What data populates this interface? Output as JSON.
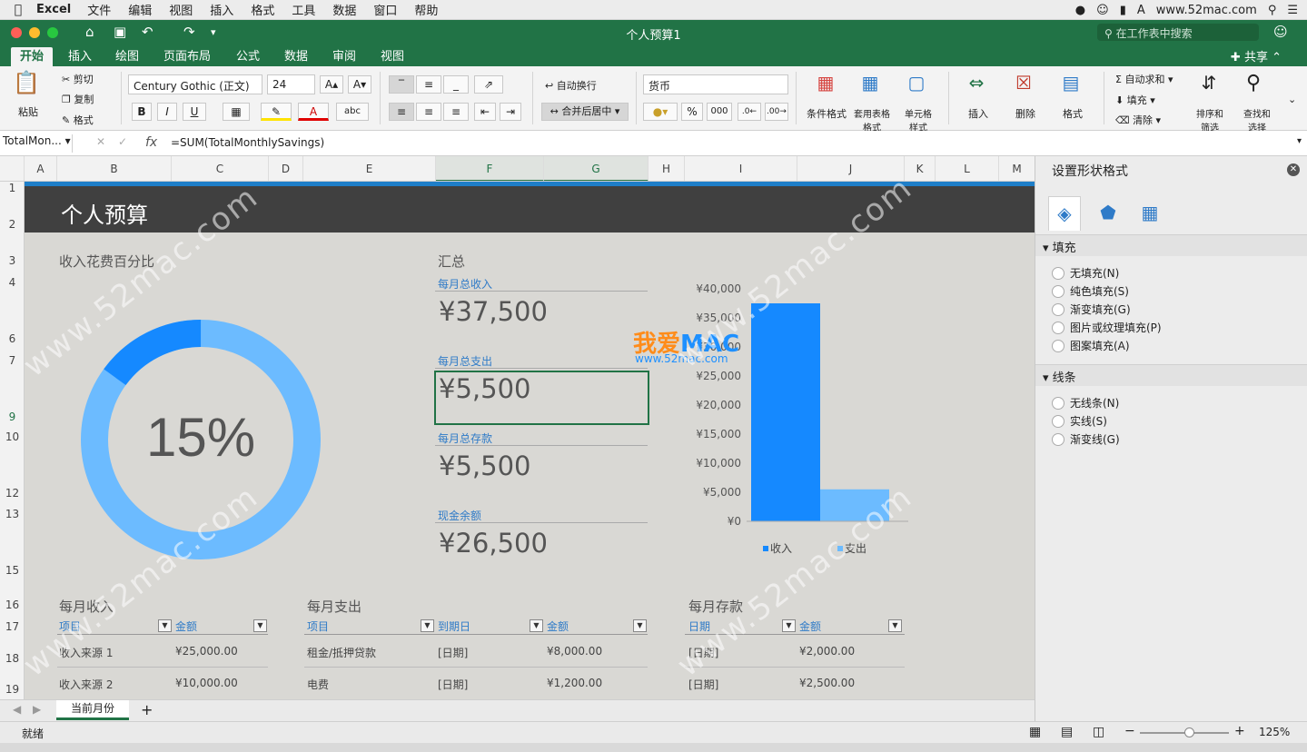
{
  "menubar": {
    "app": "Excel",
    "items": [
      "文件",
      "编辑",
      "视图",
      "插入",
      "格式",
      "工具",
      "数据",
      "窗口",
      "帮助"
    ],
    "site": "www.52mac.com"
  },
  "window": {
    "title": "个人预算1",
    "search_placeholder": "在工作表中搜索",
    "share": "共享"
  },
  "tabs": [
    "开始",
    "插入",
    "绘图",
    "页面布局",
    "公式",
    "数据",
    "审阅",
    "视图"
  ],
  "ribbon": {
    "paste": "粘贴",
    "cut": "剪切",
    "copy": "复制",
    "format_painter": "格式",
    "font_name": "Century Gothic (正文)",
    "font_size": "24",
    "bold": "B",
    "italic": "I",
    "underline": "U",
    "wrap": "自动换行",
    "merge": "合并后居中",
    "number_format": "货币",
    "percent": "%",
    "thousands": "000",
    "cond_format": "条件格式",
    "table_format": "套用表格格式",
    "cell_style": "单元格样式",
    "insert": "插入",
    "delete": "删除",
    "format": "格式",
    "autosum": "自动求和",
    "fill": "填充",
    "clear": "清除",
    "sort": "排序和筛选",
    "find": "查找和选择"
  },
  "formula_bar": {
    "name_box": "TotalMon...",
    "fx": "fx",
    "formula": "=SUM(TotalMonthlySavings)"
  },
  "columns": [
    "A",
    "B",
    "C",
    "D",
    "E",
    "F",
    "G",
    "H",
    "I",
    "J",
    "K",
    "L",
    "M"
  ],
  "rows": [
    "1",
    "2",
    "3",
    "4",
    "6",
    "7",
    "9",
    "10",
    "12",
    "13",
    "15",
    "16",
    "17",
    "18",
    "19"
  ],
  "sheet": {
    "title": "个人预算",
    "donut": {
      "label": "收入花费百分比",
      "percent_text": "15%",
      "percent": 0.15,
      "colors": {
        "spent": "#1589ff",
        "rest": "#6cbbff"
      }
    },
    "summary": {
      "heading": "汇总",
      "items": [
        {
          "label": "每月总收入",
          "value": "¥37,500"
        },
        {
          "label": "每月总支出",
          "value": "¥5,500"
        },
        {
          "label": "每月总存款",
          "value": "¥5,500"
        },
        {
          "label": "现金余额",
          "value": "¥26,500"
        }
      ]
    },
    "income": {
      "title": "每月收入",
      "headers": [
        "项目",
        "金额"
      ],
      "rows": [
        [
          "收入来源 1",
          "¥25,000.00"
        ],
        [
          "收入来源 2",
          "¥10,000.00"
        ]
      ]
    },
    "expense": {
      "title": "每月支出",
      "headers": [
        "项目",
        "到期日",
        "金额"
      ],
      "rows": [
        [
          "租金/抵押贷款",
          "[日期]",
          "¥8,000.00"
        ],
        [
          "电费",
          "[日期]",
          "¥1,200.00"
        ]
      ]
    },
    "savings": {
      "title": "每月存款",
      "headers": [
        "日期",
        "金额"
      ],
      "rows": [
        [
          "[日期]",
          "¥2,000.00"
        ],
        [
          "[日期]",
          "¥2,500.00"
        ]
      ]
    }
  },
  "chart_data": {
    "type": "bar",
    "categories": [
      "收入",
      "支出"
    ],
    "values": [
      37500,
      5500
    ],
    "colors": [
      "#1589ff",
      "#6cbbff"
    ],
    "ylim": [
      0,
      40000
    ],
    "yticks": [
      "¥0",
      "¥5,000",
      "¥10,000",
      "¥15,000",
      "¥20,000",
      "¥25,000",
      "¥30,000",
      "¥35,000",
      "¥40,000"
    ],
    "legend": [
      "收入",
      "支出"
    ],
    "legend_position": "bottom"
  },
  "watermark": {
    "brand_a": "我爱",
    "brand_b": "MAC",
    "url": "www.52mac.com"
  },
  "pane": {
    "title": "设置形状格式",
    "fill_section": "填充",
    "fill_options": [
      "无填充(N)",
      "纯色填充(S)",
      "渐变填充(G)",
      "图片或纹理填充(P)",
      "图案填充(A)"
    ],
    "line_section": "线条",
    "line_options": [
      "无线条(N)",
      "实线(S)",
      "渐变线(G)"
    ]
  },
  "sheet_tab": "当前月份",
  "status": {
    "ready": "就绪",
    "zoom": "125%"
  }
}
